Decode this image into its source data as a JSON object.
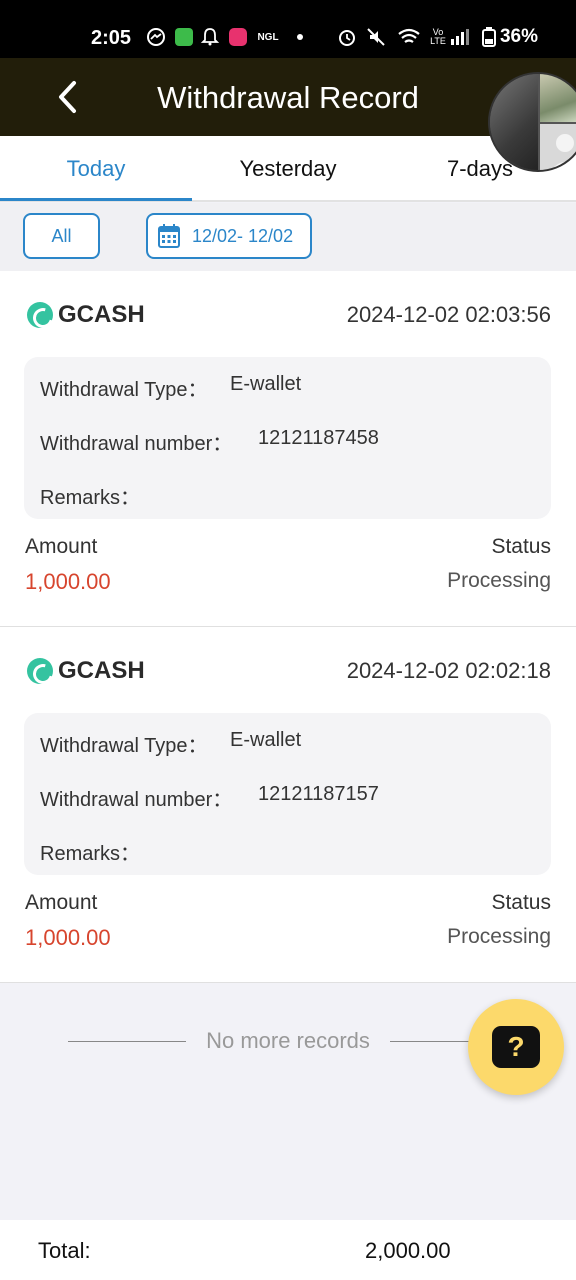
{
  "status_bar": {
    "time": "2:05",
    "battery": "36%",
    "icons": [
      "messenger-icon",
      "app-icon",
      "bell-icon",
      "ngl-app-icon",
      "ngl-text-icon",
      "dot-icon",
      "alarm-icon",
      "mute-icon",
      "wifi-icon",
      "volte-icon",
      "signal-icon",
      "battery-icon"
    ],
    "ngl_label": "NGL"
  },
  "header": {
    "title": "Withdrawal Record",
    "back_icon": "chevron-left-icon"
  },
  "tabs": [
    {
      "label": "Today",
      "active": true
    },
    {
      "label": "Yesterday",
      "active": false
    },
    {
      "label": "7-days",
      "active": false
    }
  ],
  "filter": {
    "all_label": "All",
    "date_range": "12/02- 12/02"
  },
  "records": [
    {
      "provider": "GCASH",
      "datetime": "2024-12-02 02:03:56",
      "type_label": "Withdrawal Type：",
      "type_value": "E-wallet",
      "number_label": "Withdrawal number：",
      "number_value": "12121187458",
      "remarks_label": "Remarks：",
      "amount_label": "Amount",
      "amount_value": "1,000.00",
      "status_label": "Status",
      "status_value": "Processing"
    },
    {
      "provider": "GCASH",
      "datetime": "2024-12-02 02:02:18",
      "type_label": "Withdrawal Type：",
      "type_value": "E-wallet",
      "number_label": "Withdrawal number：",
      "number_value": "12121187157",
      "remarks_label": "Remarks：",
      "amount_label": "Amount",
      "amount_value": "1,000.00",
      "status_label": "Status",
      "status_value": "Processing"
    }
  ],
  "no_more": "No more records",
  "help": {
    "icon": "question-mark-icon",
    "text": "?"
  },
  "footer": {
    "total_label": "Total:",
    "total_value": "2,000.00"
  },
  "colors": {
    "accent": "#2b86c9",
    "header_bg": "#221e0a",
    "amount": "#d7452e",
    "help_bg": "#fcd96b",
    "gcash": "#34c3a0"
  }
}
